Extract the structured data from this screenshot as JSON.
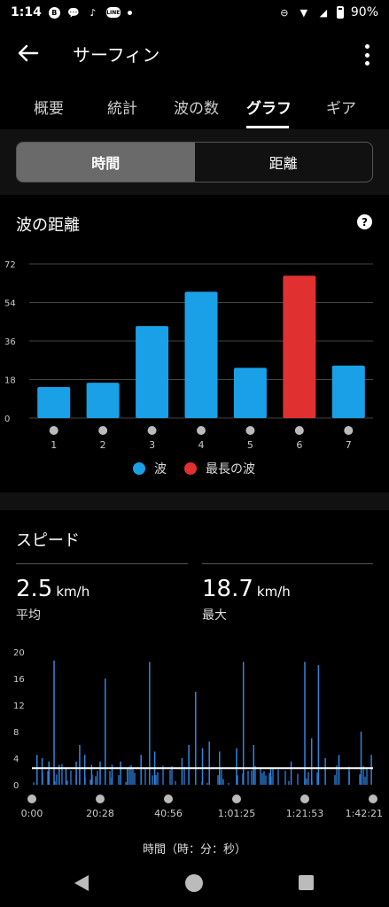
{
  "status_bar": {
    "time": "1:14",
    "battery": "90%"
  },
  "app_bar": {
    "title": "サーフィン"
  },
  "tabs": [
    {
      "label": "概要"
    },
    {
      "label": "統計"
    },
    {
      "label": "波の数"
    },
    {
      "label": "グラフ",
      "active": true
    },
    {
      "label": "ギア"
    }
  ],
  "segmented": {
    "time_label": "時間",
    "distance_label": "距離",
    "selected": "時間"
  },
  "wave_distance": {
    "title": "波の距離",
    "legend": {
      "wave": "波",
      "longest": "最長の波"
    },
    "colors": {
      "wave": "#1aa0e6",
      "longest": "#e03030"
    }
  },
  "speed": {
    "title": "スピード",
    "avg": {
      "value": "2.5",
      "unit": "km/h",
      "label": "平均"
    },
    "max": {
      "value": "18.7",
      "unit": "km/h",
      "label": "最大"
    },
    "x_axis_title": "時間（時：分：秒）"
  },
  "chart_data": [
    {
      "type": "bar",
      "title": "波の距離",
      "categories": [
        "1",
        "2",
        "3",
        "4",
        "5",
        "6",
        "7"
      ],
      "series": [
        {
          "name": "波",
          "values": [
            14.5,
            16.5,
            43,
            59,
            23.5,
            null,
            24.5
          ]
        },
        {
          "name": "最長の波",
          "values": [
            null,
            null,
            null,
            null,
            null,
            66.5,
            null
          ]
        }
      ],
      "y_ticks": [
        0,
        18,
        36,
        54,
        72
      ],
      "ylim": [
        0,
        72
      ],
      "grid": true,
      "legend": "bottom"
    },
    {
      "type": "bar",
      "title": "スピード",
      "x_ticks": [
        "0:00",
        "20:28",
        "40:56",
        "1:01:25",
        "1:21:53",
        "1:42:21"
      ],
      "y_ticks": [
        0,
        4,
        8,
        12,
        16,
        20
      ],
      "ylim": [
        0,
        20
      ],
      "average_line": 2.5,
      "spikes": [
        {
          "x_frac": 0.015,
          "y": 4.5
        },
        {
          "x_frac": 0.03,
          "y": 4.0
        },
        {
          "x_frac": 0.05,
          "y": 3.5
        },
        {
          "x_frac": 0.065,
          "y": 18.7
        },
        {
          "x_frac": 0.08,
          "y": 3.0
        },
        {
          "x_frac": 0.1,
          "y": 2.5
        },
        {
          "x_frac": 0.13,
          "y": 3.5
        },
        {
          "x_frac": 0.14,
          "y": 6.0
        },
        {
          "x_frac": 0.155,
          "y": 4.5
        },
        {
          "x_frac": 0.175,
          "y": 3.0
        },
        {
          "x_frac": 0.2,
          "y": 3.5
        },
        {
          "x_frac": 0.215,
          "y": 16.0
        },
        {
          "x_frac": 0.235,
          "y": 3.0
        },
        {
          "x_frac": 0.26,
          "y": 3.5
        },
        {
          "x_frac": 0.28,
          "y": 2.5
        },
        {
          "x_frac": 0.32,
          "y": 4.5
        },
        {
          "x_frac": 0.345,
          "y": 18.5
        },
        {
          "x_frac": 0.36,
          "y": 5.0
        },
        {
          "x_frac": 0.44,
          "y": 4.0
        },
        {
          "x_frac": 0.46,
          "y": 6.0
        },
        {
          "x_frac": 0.48,
          "y": 14.0
        },
        {
          "x_frac": 0.5,
          "y": 5.5
        },
        {
          "x_frac": 0.52,
          "y": 6.5
        },
        {
          "x_frac": 0.55,
          "y": 5.0
        },
        {
          "x_frac": 0.6,
          "y": 5.5
        },
        {
          "x_frac": 0.62,
          "y": 18.5
        },
        {
          "x_frac": 0.65,
          "y": 6.0
        },
        {
          "x_frac": 0.7,
          "y": 2.5
        },
        {
          "x_frac": 0.76,
          "y": 3.5
        },
        {
          "x_frac": 0.8,
          "y": 18.5
        },
        {
          "x_frac": 0.82,
          "y": 7.0
        },
        {
          "x_frac": 0.84,
          "y": 18.0
        },
        {
          "x_frac": 0.86,
          "y": 4.0
        },
        {
          "x_frac": 0.9,
          "y": 4.5
        },
        {
          "x_frac": 0.93,
          "y": 2.0
        },
        {
          "x_frac": 0.965,
          "y": 8.0
        },
        {
          "x_frac": 0.995,
          "y": 4.5
        }
      ]
    }
  ]
}
